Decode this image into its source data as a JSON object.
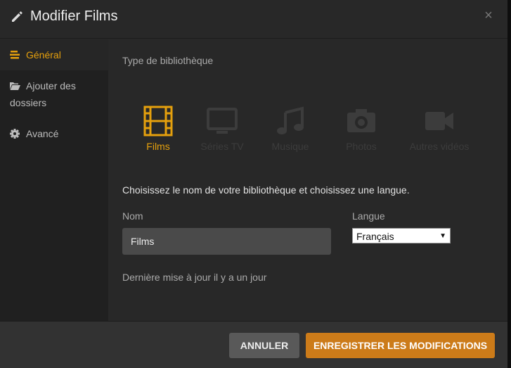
{
  "header": {
    "title": "Modifier Films",
    "close_glyph": "×"
  },
  "sidebar": {
    "items": [
      {
        "label": "Général",
        "icon": "list-icon"
      },
      {
        "label": "Ajouter des dossiers",
        "icon": "folder-icon"
      },
      {
        "label": "Avancé",
        "icon": "gear-icon"
      }
    ]
  },
  "content": {
    "section_label": "Type de bibliothèque",
    "types": [
      {
        "label": "Films",
        "icon": "film-icon",
        "active": true
      },
      {
        "label": "Séries TV",
        "icon": "tv-icon"
      },
      {
        "label": "Musique",
        "icon": "music-icon"
      },
      {
        "label": "Photos",
        "icon": "camera-icon"
      },
      {
        "label": "Autres vidéos",
        "icon": "video-camera-icon"
      }
    ],
    "prompt": "Choisissez le nom de votre bibliothèque et choisissez une langue.",
    "name_label": "Nom",
    "name_value": "Films",
    "lang_label": "Langue",
    "lang_value": "Français",
    "last_update": "Dernière mise à jour il y a un jour"
  },
  "footer": {
    "cancel_label": "ANNULER",
    "save_label": "ENREGISTRER LES MODIFICATIONS"
  },
  "colors": {
    "accent": "#e5a00d",
    "save_button": "#cc7b19",
    "inactive_icon": "#3c3c3c"
  }
}
